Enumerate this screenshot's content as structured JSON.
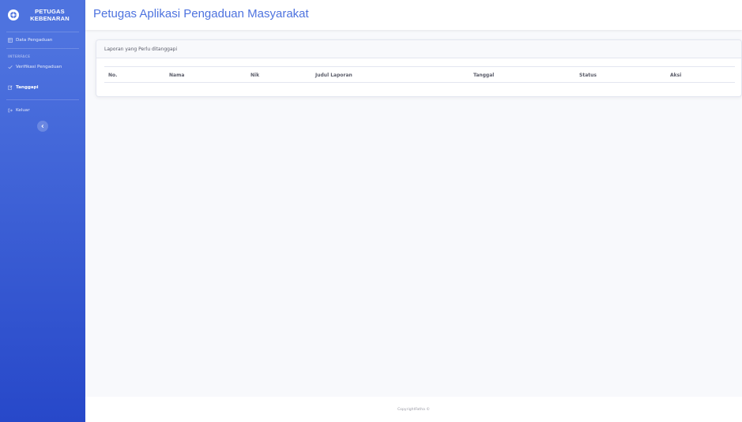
{
  "sidebar": {
    "brand_line1": "PETUGAS",
    "brand_line2": "KEBENARAN",
    "items": [
      {
        "label": "Data Pengaduan",
        "icon": "table-icon"
      },
      {
        "label": "Verifikasi Pengaduan",
        "icon": "check-icon"
      },
      {
        "label": "Tanggapi",
        "icon": "edit-icon"
      },
      {
        "label": "Keluar",
        "icon": "sign-out-icon"
      }
    ],
    "heading": "INTERFACE"
  },
  "header": {
    "title": "Petugas Aplikasi Pengaduan Masyarakat"
  },
  "card": {
    "title": "Laporan yang Perlu ditanggapi",
    "columns": [
      "No.",
      "Nama",
      "Nik",
      "Judul Laporan",
      "Tanggal",
      "Status",
      "Aksi"
    ]
  },
  "footer": {
    "text": "CopyrightFatha ©"
  },
  "colors": {
    "accent": "#4e73df",
    "sidebar_dark": "#2748c9"
  }
}
